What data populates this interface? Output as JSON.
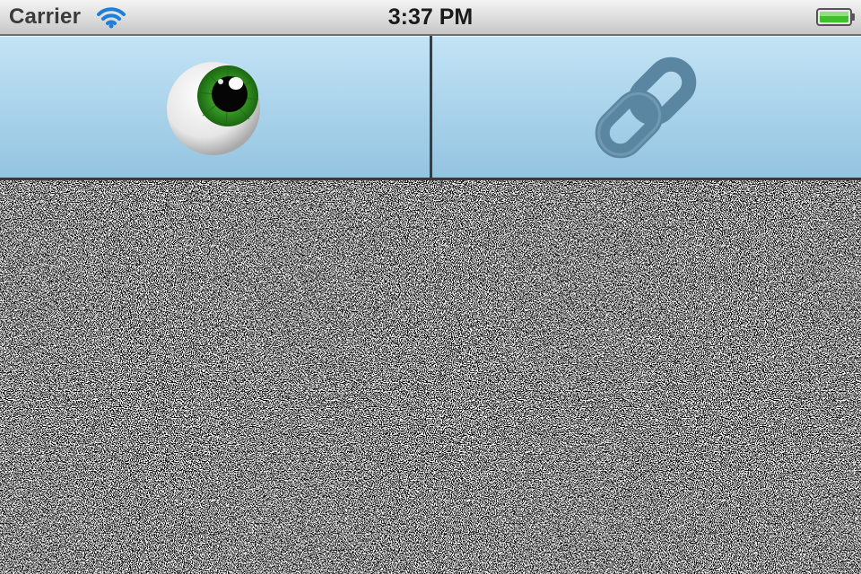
{
  "status_bar": {
    "carrier": "Carrier",
    "time": "3:37 PM",
    "wifi_icon": "wifi-icon",
    "battery_icon": "battery-icon",
    "battery_color": "#3fbf2a"
  },
  "toolbar": {
    "buttons": [
      {
        "icon": "eye-icon",
        "iris_color": "#2e8b1e"
      },
      {
        "icon": "link-icon",
        "color": "#5a86a2"
      }
    ],
    "background": "#a8d2ea"
  },
  "content": {
    "type": "tv-static-noise"
  }
}
